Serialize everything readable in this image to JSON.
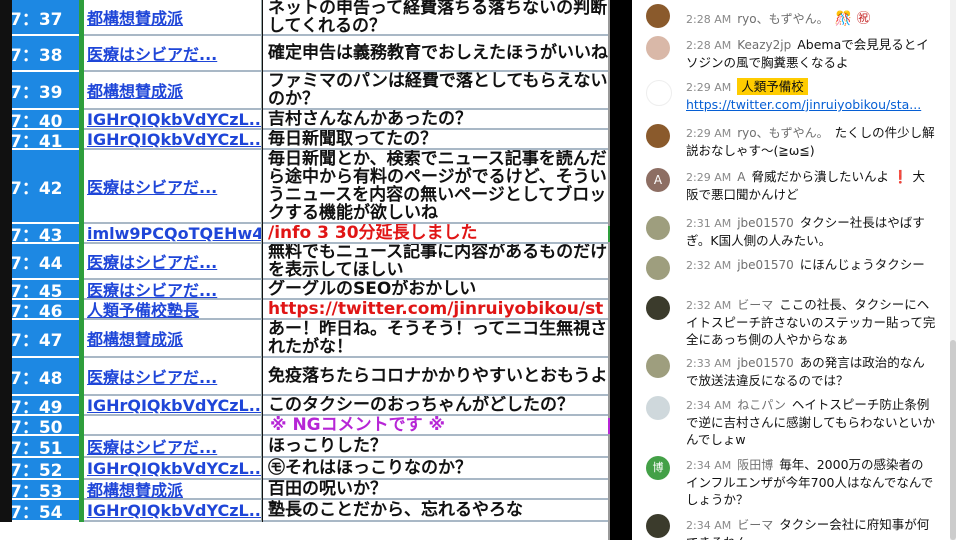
{
  "comments": [
    {
      "num": "7：37",
      "name": "都構想賛成派",
      "text": "ネットの申告って経費落ちる落ちないの判断してくれるの？",
      "style": "normal"
    },
    {
      "num": "7：38",
      "name": "医療はシビアだ...",
      "text": "確定申告は義務教育でおしえたほうがいいね",
      "style": "normal"
    },
    {
      "num": "7：39",
      "name": "都構想賛成派",
      "text": "ファミマのパンは経費で落としてもらえないのか？",
      "style": "normal"
    },
    {
      "num": "7：40",
      "name": "IGHrQIQkbVdYCzL...",
      "text": "吉村さんなんかあったの？",
      "style": "normal"
    },
    {
      "num": "7：41",
      "name": "IGHrQIQkbVdYCzL...",
      "text": "毎日新聞取ってたの？",
      "style": "normal"
    },
    {
      "num": "7：42",
      "name": "医療はシビアだ...",
      "text": "毎日新聞とか、検索でニュース記事を読んだら途中から有料のページがでるけど、そういうニュースを内容の無いページとしてブロックする機能が欲しいね",
      "style": "normal"
    },
    {
      "num": "7：43",
      "name": "imlw9PCQoTQEHw4...",
      "text": "/info 3 30分延長しました",
      "style": "red"
    },
    {
      "num": "7：44",
      "name": "医療はシビアだ...",
      "text": "無料でもニュース記事に内容があるものだけを表示してほしい",
      "style": "normal"
    },
    {
      "num": "7：45",
      "name": "医療はシビアだ...",
      "text": "グーグルのSEOがおかしい",
      "style": "normal"
    },
    {
      "num": "7：46",
      "name": "人類予備校塾長",
      "text": "https://twitter.com/jinruiyobikou/st",
      "style": "link"
    },
    {
      "num": "7：47",
      "name": "都構想賛成派",
      "text": "あー！昨日ね。そうそう！ってニコ生無視されたがな！",
      "style": "normal"
    },
    {
      "num": "7：48",
      "name": "医療はシビアだ...",
      "text": "免疫落ちたらコロナかかりやすいとおもうよ",
      "style": "normal"
    },
    {
      "num": "7：49",
      "name": "IGHrQIQkbVdYCzL...",
      "text": "このタクシーのおっちゃんがどしたの？",
      "style": "normal"
    },
    {
      "num": "7：50",
      "name": "",
      "text": "※ NGコメントです ※",
      "style": "purple"
    },
    {
      "num": "7：51",
      "name": "医療はシビアだ...",
      "text": "ほっこりした？",
      "style": "normal"
    },
    {
      "num": "7：52",
      "name": "IGHrQIQkbVdYCzL...",
      "text": "㋲それはほっこりなのか？",
      "style": "normal"
    },
    {
      "num": "7：53",
      "name": "都構想賛成派",
      "text": "百田の呪いか？",
      "style": "normal"
    },
    {
      "num": "7：54",
      "name": "IGHrQIQkbVdYCzL...",
      "text": "塾長のことだから、忘れるやろな",
      "style": "normal"
    }
  ],
  "chat": [
    {
      "time": "2:28 AM",
      "author": "ryo、もずやん。",
      "text": "",
      "badge": "",
      "link": "",
      "avatar_color": "#8a5a2c",
      "emoji": "🎊 ㊗"
    },
    {
      "time": "2:28 AM",
      "author": "Keazy2jp",
      "text": "Abemaで会見見るとイソジンの風で胸糞悪くなるよ",
      "badge": "",
      "link": "",
      "avatar_color": "#d9b8a8",
      "emoji": ""
    },
    {
      "time": "2:29 AM",
      "author": "",
      "text": "",
      "badge": "人類予備校",
      "link": "https://twitter.com/jinruiyobikou/sta...",
      "avatar_color": "#ffffff",
      "emoji": ""
    },
    {
      "time": "2:29 AM",
      "author": "ryo、もずやん。",
      "text": "たくしの件少し解説おなしゃす〜(≧ω≦)",
      "badge": "",
      "link": "",
      "avatar_color": "#8a5a2c",
      "emoji": ""
    },
    {
      "time": "2:29 AM",
      "author": "A",
      "text": "脅威だから潰したいんよ ❗ 大阪で悪口聞かんけど",
      "badge": "",
      "link": "",
      "avatar_color": "#8d6e63",
      "emoji": "",
      "avatar_letter": "A"
    },
    {
      "time": "2:31 AM",
      "author": "jbe01570",
      "text": "タクシー社長はやばすぎ。K国人側の人みたい。",
      "badge": "",
      "link": "",
      "avatar_color": "#9e9e7e",
      "emoji": ""
    },
    {
      "time": "2:32 AM",
      "author": "jbe01570",
      "text": "にほんじょうタクシー",
      "badge": "",
      "link": "",
      "avatar_color": "#9e9e7e",
      "emoji": ""
    },
    {
      "time": "2:32 AM",
      "author": "ビーマ",
      "text": "ここの社長、タクシーにヘイトスピーチ許さないのステッカー貼って完全にあっち側の人やからなぁ",
      "badge": "",
      "link": "",
      "avatar_color": "#3b3b2c",
      "emoji": ""
    },
    {
      "time": "2:33 AM",
      "author": "jbe01570",
      "text": "あの発言は政治的なんで放送法違反になるのでは？",
      "badge": "",
      "link": "",
      "avatar_color": "#9e9e7e",
      "emoji": ""
    },
    {
      "time": "2:34 AM",
      "author": "ねこパン",
      "text": "ヘイトスピーチ防止条例で逆に吉村さんに感謝してもらわないといかんでしょw",
      "badge": "",
      "link": "",
      "avatar_color": "#cfd8dc",
      "emoji": ""
    },
    {
      "time": "2:34 AM",
      "author": "阪田博",
      "text": "毎年、2000万の感染者のインフルエンザが今年700人はなんでなんでしょうか？",
      "badge": "",
      "link": "",
      "avatar_color": "#43a047",
      "emoji": "",
      "avatar_letter": "博"
    },
    {
      "time": "2:34 AM",
      "author": "ビーマ",
      "text": "タクシー会社に府知事が何できるねん",
      "badge": "",
      "link": "",
      "avatar_color": "#3b3b2c",
      "emoji": ""
    }
  ]
}
